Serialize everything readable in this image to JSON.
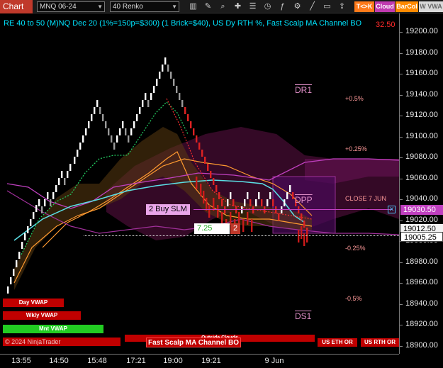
{
  "toolbar": {
    "tab_label": "Chart",
    "instrument": "MNQ 06-24",
    "interval": "40 Renko",
    "chips": {
      "tk": "T<>K",
      "cloud": "Cloud",
      "barcol": "BarCol",
      "vwap": "W VWA"
    }
  },
  "chart": {
    "title": "RE 40 to 50 (M)NQ Dec 20 (1%=150p=$300) (1 Brick=$40), US Dy RTH %, Fast Scalp MA Channel BO",
    "title_red": "32.50",
    "levels": {
      "p05": "+0.5%",
      "p025": "+0.25%",
      "close": "CLOSE 7 JUN",
      "m025": "-0.25%",
      "m05": "-0.5%",
      "dr1": "DR1",
      "dpp": "DPP",
      "ds1": "DS1"
    },
    "annotations": {
      "buy_slm": "2 Buy SLM",
      "pnl": "7.25",
      "qty": "2",
      "outside_clouds": "Outside Clouds"
    },
    "legend": {
      "day_vwap": "Day VWAP",
      "wkly_vwap": "Wkly VWAP",
      "mnt_vwap": "Mnt VWAP",
      "copyright": "© 2024 NinjaTrader",
      "fast_scalp": "Fast Scalp MA Channel BO",
      "us_eth_or": "US ETH OR",
      "us_rth_or": "US RTH OR"
    }
  },
  "price_axis": {
    "ticks": [
      "19200.00",
      "19180.00",
      "19160.00",
      "19140.00",
      "19120.00",
      "19100.00",
      "19080.00",
      "19060.00",
      "19040.00",
      "19020.00",
      "19000.00",
      "18980.00",
      "18960.00",
      "18940.00",
      "18920.00",
      "18900.00"
    ],
    "labels": {
      "current": "19030.50",
      "dpp_value": "19012.50",
      "last": "19005.25"
    }
  },
  "time_axis": {
    "ticks": [
      "13:55",
      "14:50",
      "15:48",
      "17:21",
      "19:00",
      "19:21",
      "9 Jun"
    ]
  },
  "colors": {
    "accent_red": "#c0392b",
    "cyan": "#00e5ff",
    "magenta": "#c040c0",
    "orange": "#ff9a30",
    "green": "#22c55e"
  }
}
